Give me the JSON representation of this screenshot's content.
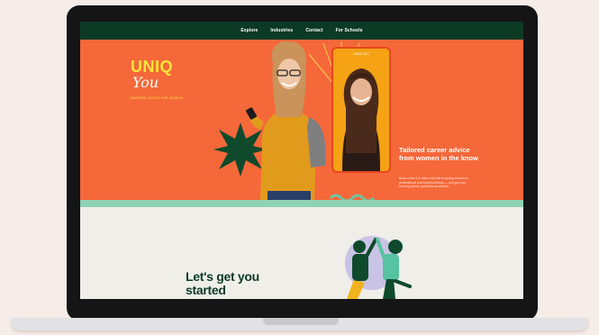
{
  "nav": {
    "items": [
      "Explore",
      "Industries",
      "Contact",
      "For Schools"
    ]
  },
  "hero": {
    "logo_main": "UNIQ",
    "logo_sub": "You",
    "logo_tagline": "CAREERS ADVICE FOR WOMEN",
    "heading": "Tailored career advice from women in the know",
    "body": "Book a free 1:1 video call with inspiring women in professional and technical fields — and get your burning career questions answered.",
    "phone_title": "UNIQ YOU"
  },
  "lower": {
    "heading": "Let's get you started"
  },
  "colors": {
    "nav_bg": "#0c3a25",
    "hero_bg": "#f5683a",
    "accent_yellow": "#f7e63a",
    "stripe": "#8fd3b6",
    "dark_green": "#0c3a25"
  }
}
